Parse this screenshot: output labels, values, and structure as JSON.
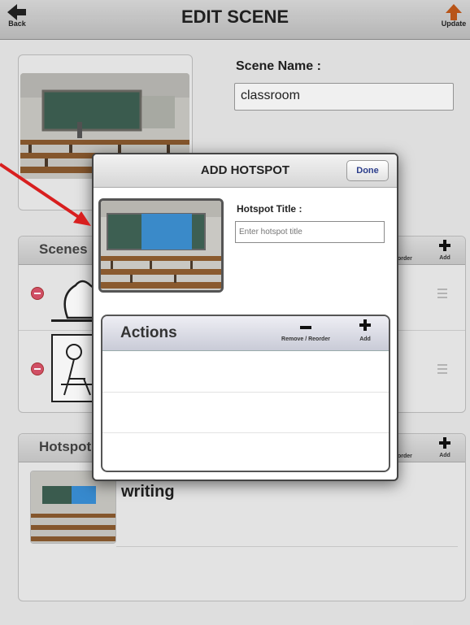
{
  "header": {
    "title": "EDIT SCENE",
    "back_label": "Back",
    "update_label": "Update"
  },
  "scene": {
    "name_label": "Scene Name :",
    "name_value": "classroom"
  },
  "scenes_section": {
    "title": "Scenes",
    "reorder_label": "Reorder",
    "add_label": "Add"
  },
  "hotspots_section": {
    "title": "Hotspots",
    "reorder_label": "Reorder",
    "add_label": "Add",
    "items": [
      {
        "label": "writing"
      }
    ]
  },
  "modal": {
    "title": "ADD HOTSPOT",
    "done_label": "Done",
    "hotspot_title_label": "Hotspot Title :",
    "hotspot_title_placeholder": "Enter hotspot title",
    "actions": {
      "title": "Actions",
      "remove_reorder_label": "Remove / Reorder",
      "add_label": "Add"
    }
  },
  "colors": {
    "annotation_arrow": "#d81f1f",
    "accent_update": "#c0581a",
    "done_text": "#2c3e8c"
  }
}
